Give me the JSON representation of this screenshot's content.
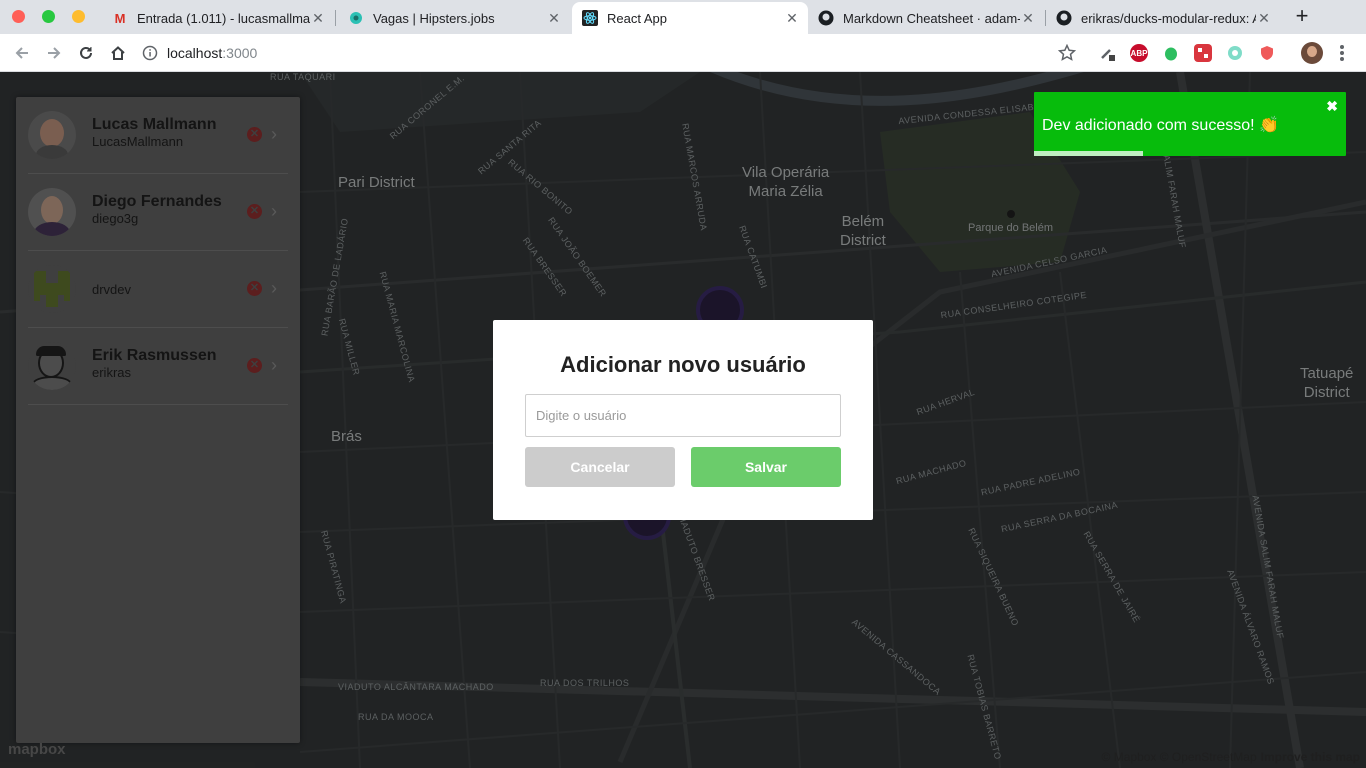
{
  "browser": {
    "tabs": [
      {
        "title": "Entrada (1.011) - lucasmallmann",
        "icon": "gmail-icon"
      },
      {
        "title": "Vagas | Hipsters.jobs",
        "icon": "hipsters-icon"
      },
      {
        "title": "React App",
        "icon": "react-icon"
      },
      {
        "title": "Markdown Cheatsheet · adam-p",
        "icon": "github-icon"
      },
      {
        "title": "erikras/ducks-modular-redux: A",
        "icon": "github-icon"
      }
    ],
    "url_host": "localhost",
    "url_port": ":3000",
    "extensions": [
      "colorpicker-icon",
      "adblock-icon",
      "evernote-icon",
      "extension-icon",
      "extension-icon",
      "shield-icon"
    ]
  },
  "map": {
    "districts": [
      "Pari District",
      "Vila Operária\nMaria Zélia",
      "Belém\nDistrict",
      "Brás",
      "Tatuapé\nDistrict"
    ],
    "poi": "Parque do Belém",
    "streets": [
      "RUA TAQUARI",
      "AVENIDA CONDESSA ELISABETH",
      "RUA SANTA RITA",
      "RUA RIO BONITO",
      "RUA MARCOS ARRUDA",
      "RUA CATUMBI",
      "AVENIDA CELSO GARCIA",
      "RUA CONSELHEIRO COTEGIPE",
      "RUA SALIM FARAH MALUF",
      "RUA HERVAL",
      "RUA PADRE ADELINO",
      "RUA SERRA DA BOCAINA",
      "RUA SIQUEIRA BUENO",
      "VIADUTO BRESSER",
      "AVENIDA CASSANDOCA",
      "VIADUTO ALCÂNTARA MACHADO",
      "RUA DOS TRILHOS",
      "RUA DA MOOCA",
      "RUA MARIA MARCOLINA",
      "RUA JOÃO BOEMER",
      "RUA BRESSER",
      "RUA MILLER",
      "RUA BARÃO DE LADÁRIO",
      "RUA SERRA DE JAIRÉ",
      "AVENIDA ÁLVARO RAMOS",
      "RUA TOBIAS BARRETO",
      "AVENIDA SALIM FARAH MALUF",
      "RUA CORONEL E.M.",
      "RUA PIRATINGA",
      "RUA MACHADO"
    ],
    "attribution": "© Mapbox © OpenStreetMap",
    "improve": "Improve this map",
    "logo": "mapbox"
  },
  "sidebar": {
    "users": [
      {
        "name": "Lucas Mallmann",
        "login": "LucasMallmann"
      },
      {
        "name": "Diego Fernandes",
        "login": "diego3g"
      },
      {
        "name": "",
        "login": "drvdev"
      },
      {
        "name": "Erik Rasmussen",
        "login": "erikras"
      }
    ]
  },
  "modal": {
    "title": "Adicionar novo usuário",
    "input_placeholder": "Digite o usuário",
    "cancel_label": "Cancelar",
    "save_label": "Salvar"
  },
  "toast": {
    "message": "Dev adicionado com sucesso! 👏",
    "close": "✖",
    "progress": 0.35
  }
}
